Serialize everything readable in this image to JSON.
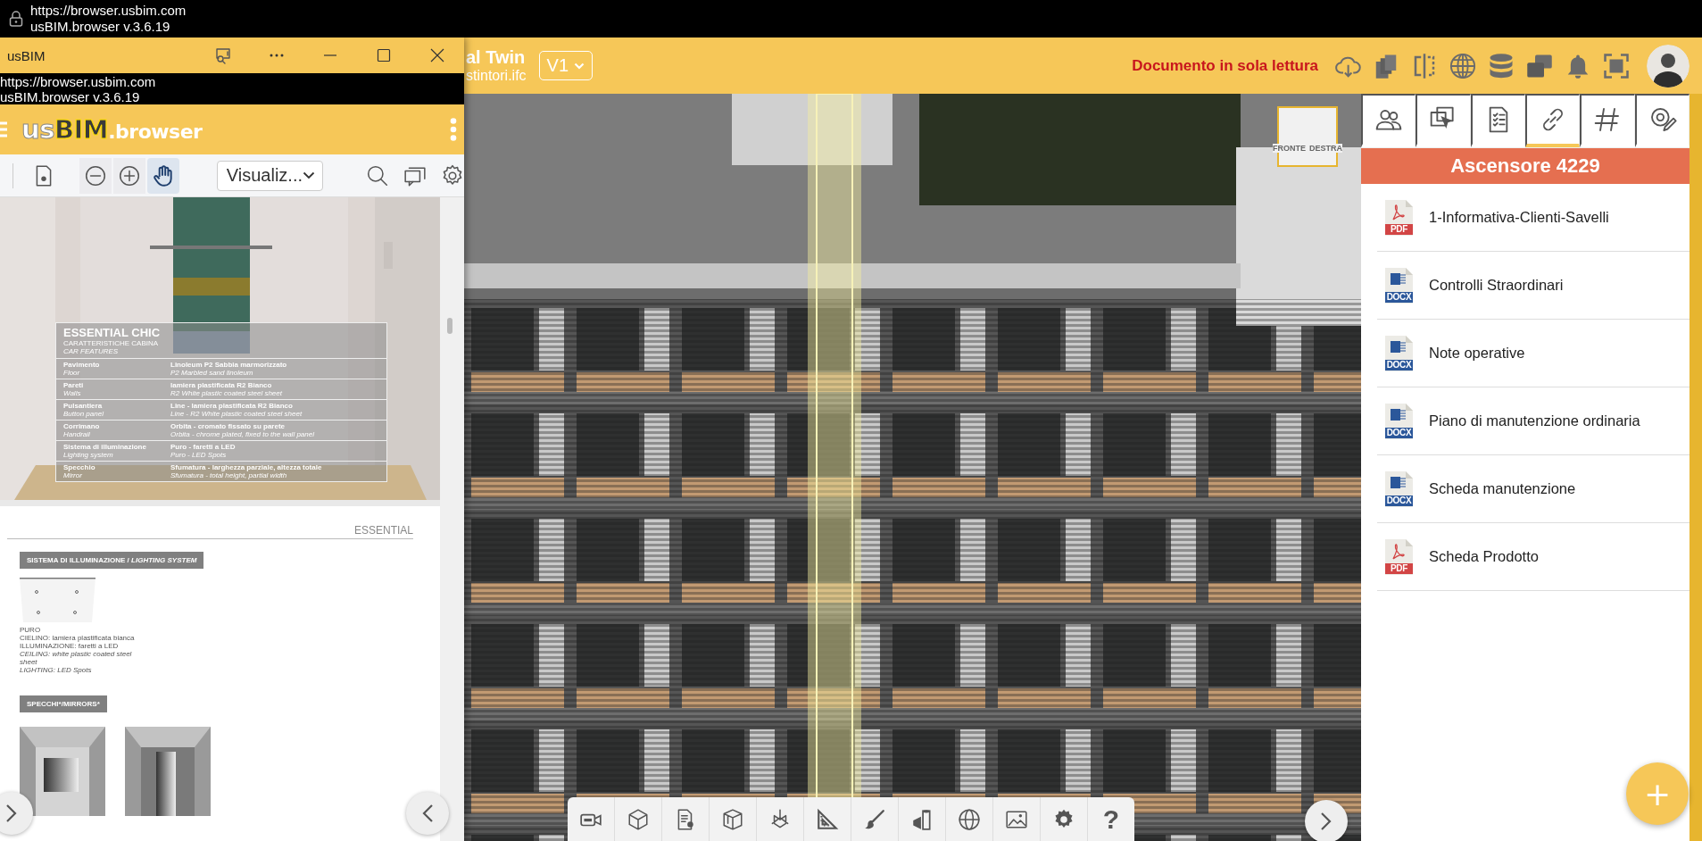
{
  "browser_bar": {
    "url": "https://browser.usbim.com",
    "title": "usBIM.browser v.3.6.19"
  },
  "header": {
    "title": "al Twin",
    "subtitle": "stintori.ifc",
    "version": "V1",
    "notice": "Documento in sola lettura"
  },
  "viewport": {
    "view_cube": [
      "FRONTE",
      "DESTRA"
    ],
    "toolbar": {
      "help": "?"
    }
  },
  "panel": {
    "tabs": [
      {
        "selected": false
      },
      {
        "selected": false
      },
      {
        "selected": false
      },
      {
        "selected": true
      },
      {
        "selected": false
      },
      {
        "selected": false
      }
    ],
    "title": "Ascensore 4229",
    "documents": [
      {
        "name": "1-Informativa-Clienti-Savelli",
        "kind": "pdf",
        "badge": "PDF"
      },
      {
        "name": "Controlli Straordinari",
        "kind": "docx",
        "badge": "DOCX"
      },
      {
        "name": "Note operative",
        "kind": "docx",
        "badge": "DOCX"
      },
      {
        "name": "Piano di manutenzione ordinaria",
        "kind": "docx",
        "badge": "DOCX"
      },
      {
        "name": "Scheda manutenzione",
        "kind": "docx",
        "badge": "DOCX"
      },
      {
        "name": "Scheda Prodotto",
        "kind": "pdf",
        "badge": "PDF"
      }
    ],
    "fab": "+"
  },
  "popup_window": {
    "title": "usBIM",
    "url": "https://browser.usbim.com",
    "version": "usBIM.browser v.3.6.19",
    "logo": {
      "part_1": "us",
      "part_2": "BIM",
      "part_3": ".browser"
    },
    "toolbar": {
      "tools": [
        {
          "selected": false
        },
        {
          "selected": false
        },
        {
          "selected": false
        },
        {
          "selected": true
        }
      ],
      "view_mode": "Visualiz..."
    },
    "document": {
      "page_1": {
        "title": "ESSENTIAL CHIC",
        "subtitle": "CARATTERISTICHE CABINA",
        "subtitle_en": "CAR FEATURES",
        "rows": [
          {
            "label": "Pavimento",
            "label_en": "Floor",
            "value": "Linoleum P2 Sabbia marmorizzato",
            "value_en": "P2 Marbled sand linoleum"
          },
          {
            "label": "Pareti",
            "label_en": "Walls",
            "value": "lamiera plastificata R2 Bianco",
            "value_en": "R2 White plastic coated steel sheet"
          },
          {
            "label": "Pulsantiera",
            "label_en": "Button panel",
            "value": "Line - lamiera plastificata R2 Bianco",
            "value_en": "Line - R2 White plastic coated steel sheet"
          },
          {
            "label": "Corrimano",
            "label_en": "Handrail",
            "value": "Orbita - cromato fissato su parete",
            "value_en": "Orbita - chrome plated, fixed to the wall panel"
          },
          {
            "label": "Sistema di illuminazione",
            "label_en": "Lighting system",
            "value": "Puro - faretti a LED",
            "value_en": "Puro - LED Spots"
          },
          {
            "label": "Specchio",
            "label_en": "Mirror",
            "value": "Sfumatura - larghezza parziale, altezza totale",
            "value_en": "Sfumatura - total height, partial width"
          }
        ]
      },
      "page_2": {
        "header": "ESSENTIAL",
        "sections": [
          {
            "label": "SISTEMA DI ILLUMINAZIONE / *LIGHTING SYSTEM*",
            "kind": "ceiling",
            "lines": [
              {
                "text": "PURO",
                "italic": false
              },
              {
                "text": "CIELINO: lamiera plastificata bianca",
                "italic": false
              },
              {
                "text": "ILLUMINAZIONE: faretti a LED",
                "italic": false
              },
              {
                "text": "CEILING: white plastic coated steel sheet",
                "italic": true
              },
              {
                "text": "LIGHTING: LED Spots",
                "italic": true
              }
            ]
          },
          {
            "label": "SPECCHI*/MIRRORS*",
            "kind": "mirrors"
          }
        ]
      }
    }
  }
}
